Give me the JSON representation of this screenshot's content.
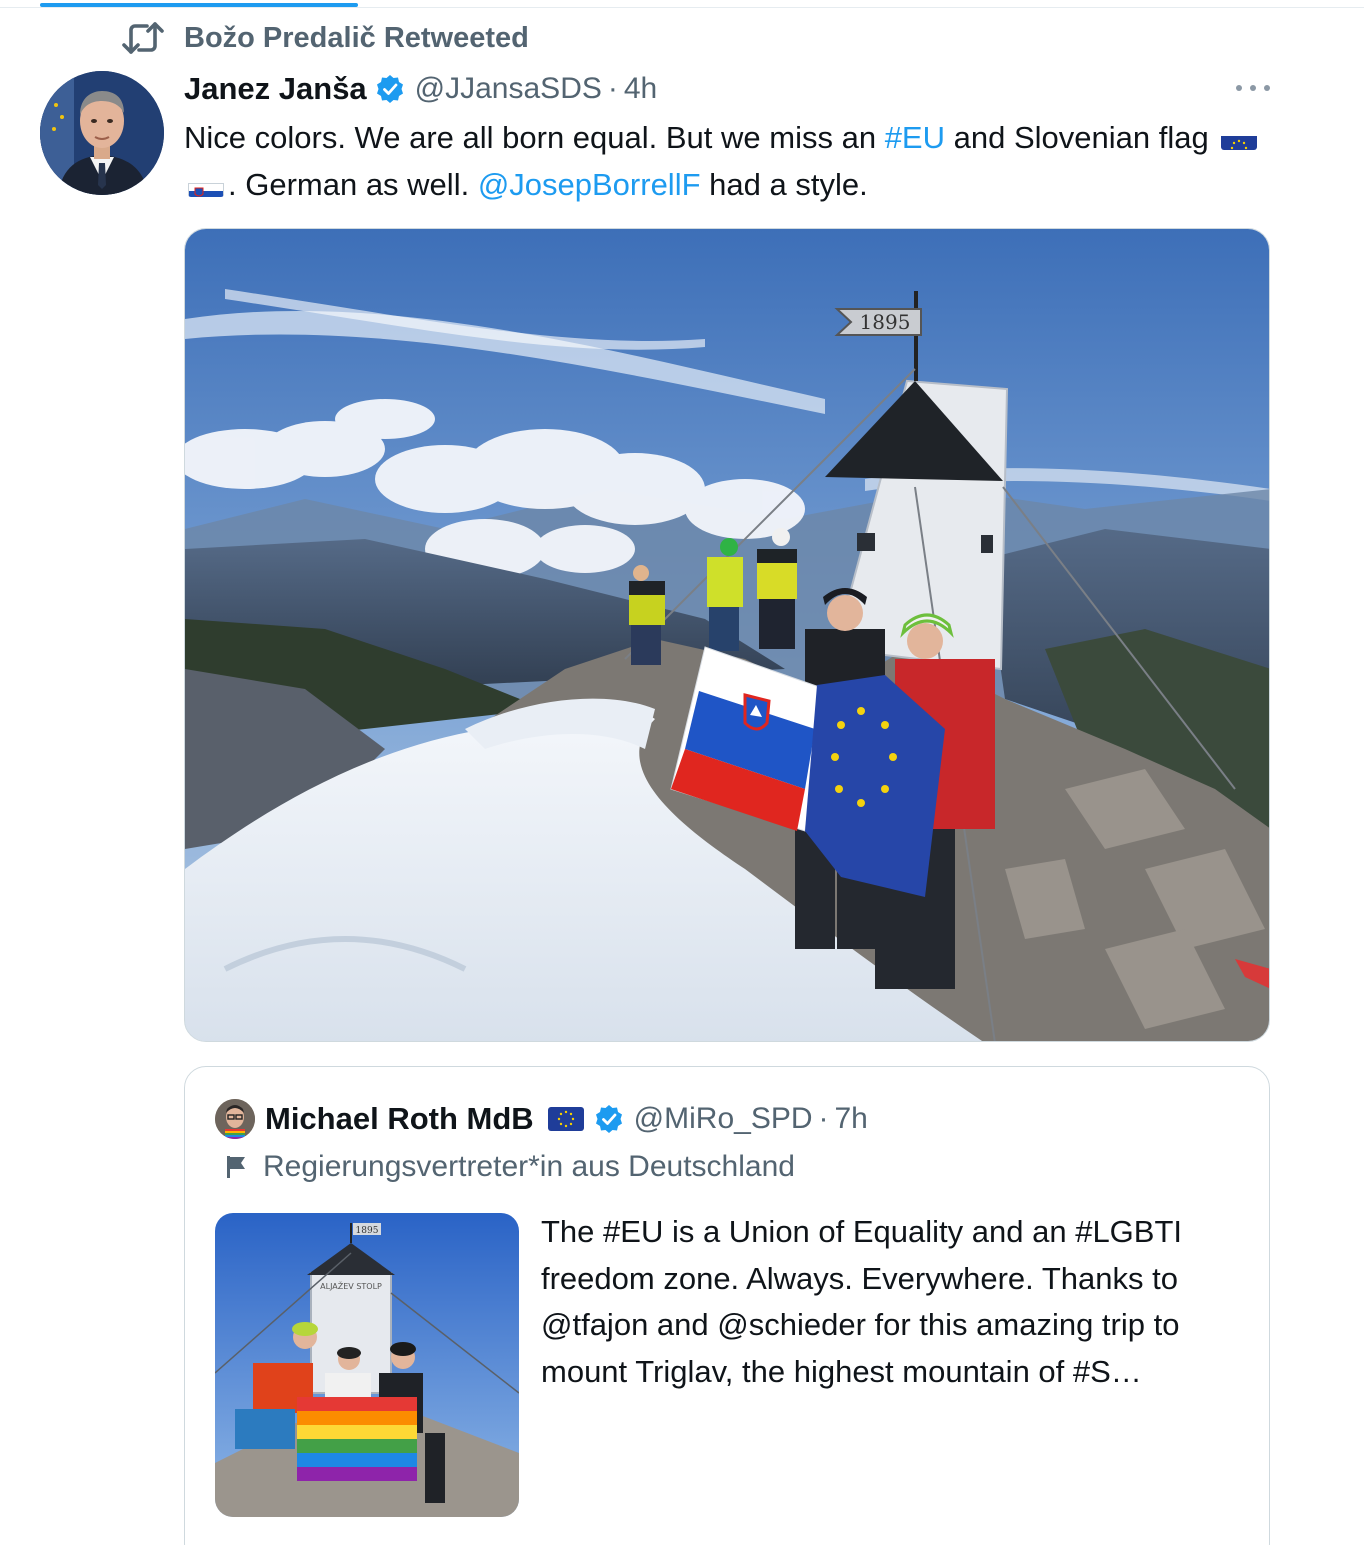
{
  "retweet": {
    "label": "Božo Predalič Retweeted"
  },
  "tweet": {
    "author_name": "Janez Janša",
    "handle": "@JJansaSDS",
    "separator": "·",
    "time": "4h",
    "text": {
      "part1": "Nice colors. We are all born equal. But we miss an ",
      "hashtag_eu": "#EU",
      "part2": " and Slovenian flag ",
      "part3": ". German as well. ",
      "mention": "@JosepBorrellF",
      "part4": " had a style."
    },
    "media": {
      "tower_plate": "1895"
    }
  },
  "quote": {
    "author_name": "Michael Roth MdB",
    "handle": "@MiRo_SPD",
    "separator": "·",
    "time": "7h",
    "label": "Regierungsvertreter*in aus Deutschland",
    "text": "The #EU is a Union of Equality and an #LGBTI freedom zone. Always. Everywhere. Thanks to @tfajon and @schieder for this amazing trip to mount Triglav, the highest mountain of #S…",
    "thumb_plate": "1895",
    "tower_sign": "ALJAŽEV STOLP"
  },
  "colors": {
    "accent": "#1d9bf0",
    "secondary_text": "#536471",
    "primary_text": "#0f1419",
    "border": "#cfd9de"
  },
  "icons": {
    "retweet": "retweet-icon",
    "verified": "verified-badge-icon",
    "more": "more-icon",
    "label": "flag-label-icon"
  }
}
